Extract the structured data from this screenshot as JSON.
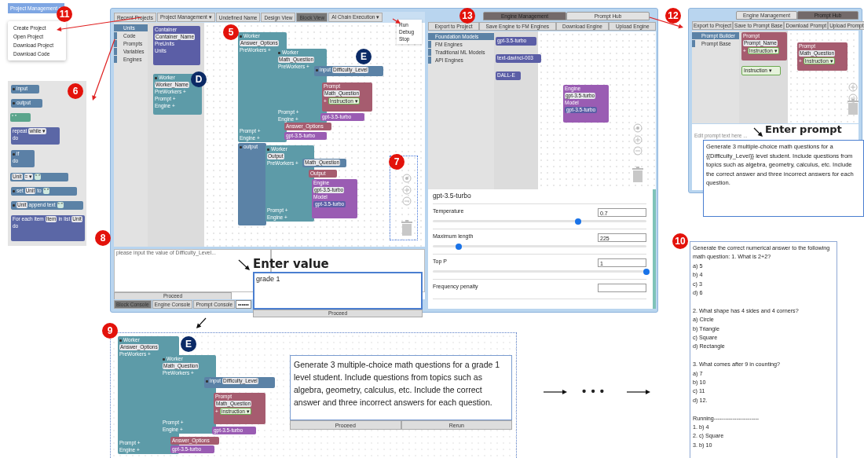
{
  "project_menu": {
    "button": "Project Management ▾",
    "items": [
      "Create Project",
      "Open Project",
      "Download Project",
      "Download Code"
    ]
  },
  "block_library": {
    "blocks": [
      {
        "kind": "io",
        "rows": [
          [
            {
              "kind": "grip"
            },
            {
              "kind": "label",
              "text": "input"
            }
          ]
        ]
      },
      {
        "kind": "io",
        "rows": [
          [
            {
              "kind": "grip"
            },
            {
              "kind": "label",
              "text": "output"
            }
          ]
        ]
      },
      {
        "kind": "text",
        "rows": [
          [
            {
              "kind": "label",
              "text": "“ ”"
            }
          ]
        ]
      },
      {
        "kind": "loop",
        "rows": [
          [
            {
              "kind": "label",
              "text": "repeat"
            },
            {
              "kind": "dropdown",
              "text": "while ▾"
            }
          ],
          [
            {
              "kind": "label",
              "text": "do"
            }
          ]
        ]
      },
      {
        "kind": "logic",
        "rows": [
          [
            {
              "kind": "grip"
            },
            {
              "kind": "label",
              "text": "if"
            }
          ],
          [
            {
              "kind": "label",
              "text": "do"
            }
          ]
        ]
      },
      {
        "kind": "var",
        "rows": [
          [
            {
              "kind": "field",
              "text": "Unit"
            },
            {
              "kind": "dropdown",
              "text": "= ▾"
            },
            {
              "kind": "quote",
              "text": "“ ”"
            }
          ]
        ]
      },
      {
        "kind": "var",
        "rows": [
          [
            {
              "kind": "grip"
            },
            {
              "kind": "label",
              "text": "set"
            },
            {
              "kind": "field",
              "text": "Unit"
            },
            {
              "kind": "label",
              "text": "to"
            },
            {
              "kind": "quote",
              "text": "“ ”"
            }
          ]
        ]
      },
      {
        "kind": "var",
        "rows": [
          [
            {
              "kind": "grip"
            },
            {
              "kind": "field",
              "text": "Unit"
            },
            {
              "kind": "label",
              "text": "append text"
            },
            {
              "kind": "quote",
              "text": "“ ”"
            }
          ]
        ]
      },
      {
        "kind": "loop",
        "rows": [
          [
            {
              "kind": "label",
              "text": "For each item"
            },
            {
              "kind": "field",
              "text": "Item"
            },
            {
              "kind": "label",
              "text": "in list"
            },
            {
              "kind": "field",
              "text": "Unit"
            }
          ],
          [
            {
              "kind": "label",
              "text": "do"
            }
          ]
        ]
      }
    ]
  },
  "main_window": {
    "toolbar": [
      {
        "label": "Recent Projects",
        "selected": false
      },
      {
        "label": "Project Management ▾",
        "selected": false
      },
      {
        "label": "Undefined Name",
        "selected": false
      },
      {
        "label": "Design View",
        "selected": false
      },
      {
        "label": "Block View",
        "selected": true
      },
      {
        "label": "AI Chain Execution ▾",
        "selected": false
      }
    ],
    "execution_menu": [
      "Run",
      "Debug",
      "Stop"
    ],
    "categories": [
      {
        "label": "Units",
        "selected": true
      },
      {
        "label": "Code",
        "selected": false
      },
      {
        "label": "Prompts",
        "selected": false
      },
      {
        "label": "Variables",
        "selected": false
      },
      {
        "label": "Engines",
        "selected": false
      }
    ],
    "flyout_blocks": [
      {
        "kind": "container",
        "rows": [
          [
            {
              "kind": "label",
              "text": "Container"
            }
          ],
          [
            {
              "kind": "field",
              "text": "Container_Name"
            }
          ],
          [
            {
              "kind": "label",
              "text": "PreUnits"
            }
          ],
          [
            {
              "kind": "label",
              "text": "Units"
            }
          ]
        ]
      },
      {
        "kind": "worker",
        "rows": [
          [
            {
              "kind": "grip"
            },
            {
              "kind": "label",
              "text": "Worker"
            }
          ],
          [
            {
              "kind": "field",
              "text": "Worker_Name"
            }
          ],
          [
            {
              "kind": "label",
              "text": "PreWorkers +"
            }
          ],
          [
            {
              "kind": "label",
              "text": "Prompt +"
            }
          ],
          [
            {
              "kind": "label",
              "text": "Engine +"
            }
          ]
        ]
      }
    ],
    "canvas_blocks": [
      {
        "kind": "worker",
        "rows": [
          [
            {
              "kind": "grip"
            },
            {
              "kind": "label",
              "text": "Worker"
            }
          ],
          [
            {
              "kind": "field",
              "text": "Answer_Options"
            }
          ],
          [
            {
              "kind": "label",
              "text": "PreWorkers +"
            }
          ],
          [
            {
              "kind": "label",
              "text": "Prompt +"
            }
          ],
          [
            {
              "kind": "label",
              "text": "Engine +"
            }
          ]
        ]
      },
      {
        "kind": "worker",
        "rows": [
          [
            {
              "kind": "grip"
            },
            {
              "kind": "label",
              "text": "Worker"
            }
          ],
          [
            {
              "kind": "field",
              "text": "Math_Question"
            }
          ],
          [
            {
              "kind": "label",
              "text": "PreWorkers +"
            }
          ],
          [
            {
              "kind": "label",
              "text": "Prompt +"
            }
          ],
          [
            {
              "kind": "label",
              "text": "Engine +"
            }
          ]
        ]
      },
      {
        "kind": "io",
        "rows": [
          [
            {
              "kind": "grip"
            },
            {
              "kind": "label",
              "text": "input"
            },
            {
              "kind": "field",
              "text": "Difficulty_Level"
            }
          ]
        ]
      },
      {
        "kind": "prompt",
        "rows": [
          [
            {
              "kind": "label",
              "text": "Prompt"
            }
          ],
          [
            {
              "kind": "field",
              "text": "Math_Question"
            }
          ],
          [
            {
              "kind": "label",
              "text": "+"
            },
            {
              "kind": "instruction",
              "text": "Instruction ▾"
            }
          ]
        ]
      },
      {
        "kind": "engine",
        "rows": [
          [
            {
              "kind": "label",
              "text": "gpt-3.5-turbo"
            }
          ]
        ]
      },
      {
        "kind": "prompt",
        "rows": [
          [
            {
              "kind": "label",
              "text": "Answer_Options"
            }
          ]
        ]
      },
      {
        "kind": "engine",
        "rows": [
          [
            {
              "kind": "label",
              "text": "gpt-3.5-turbo"
            }
          ]
        ]
      },
      {
        "kind": "io",
        "rows": [
          [
            {
              "kind": "grip"
            },
            {
              "kind": "label",
              "text": "output"
            }
          ]
        ]
      },
      {
        "kind": "worker",
        "rows": [
          [
            {
              "kind": "grip"
            },
            {
              "kind": "label",
              "text": "Worker"
            }
          ],
          [
            {
              "kind": "field",
              "text": "Output"
            }
          ],
          [
            {
              "kind": "label",
              "text": "PreWorkers +"
            }
          ],
          [
            {
              "kind": "label",
              "text": "Prompt +"
            }
          ],
          [
            {
              "kind": "label",
              "text": "Engine +"
            }
          ]
        ]
      },
      {
        "kind": "var",
        "rows": [
          [
            {
              "kind": "field",
              "text": "Math_Question"
            }
          ]
        ]
      },
      {
        "kind": "prompt",
        "rows": [
          [
            {
              "kind": "label",
              "text": "Output"
            }
          ]
        ]
      },
      {
        "kind": "engine",
        "rows": [
          [
            {
              "kind": "label",
              "text": "Engine"
            }
          ],
          [
            {
              "kind": "field",
              "text": "gpt-3.5-turbo"
            }
          ],
          [
            {
              "kind": "label",
              "text": "Model"
            }
          ],
          [
            {
              "kind": "model",
              "text": "gpt-3.5-turbo"
            }
          ]
        ]
      }
    ],
    "console": {
      "message": "please input the value of Difficulty_Level...",
      "proceed": "Proceed",
      "tabs": [
        {
          "label": "Block Console",
          "selected": true
        },
        {
          "label": "Engine Console",
          "selected": false
        },
        {
          "label": "Prompt Console",
          "selected": false
        }
      ],
      "field": "••••••"
    },
    "value_entry": {
      "callout": "Enter value",
      "value": "grade 1",
      "proceed": "Proceed"
    }
  },
  "engine_window": {
    "tabs": [
      {
        "label": "Engine Management",
        "selected": true
      },
      {
        "label": "Prompt Hub",
        "selected": false
      }
    ],
    "actions": [
      "Export to Project",
      "Save Engine to FM Engines",
      "Download Engine",
      "Upload Engine"
    ],
    "categories": [
      {
        "label": "Foundation Models",
        "selected": true
      },
      {
        "label": "FM Engines",
        "selected": false
      },
      {
        "label": "Traditional ML Models",
        "selected": false
      },
      {
        "label": "API Engines",
        "selected": false
      }
    ],
    "flyout_blocks": [
      {
        "kind": "model",
        "rows": [
          [
            {
              "kind": "label",
              "text": "gpt-3.5-turbo"
            }
          ]
        ]
      },
      {
        "kind": "model",
        "rows": [
          [
            {
              "kind": "label",
              "text": "text-davinci-003"
            }
          ]
        ]
      },
      {
        "kind": "model",
        "rows": [
          [
            {
              "kind": "label",
              "text": "DALL-E"
            }
          ]
        ]
      }
    ],
    "canvas_blocks": [
      {
        "kind": "engine",
        "rows": [
          [
            {
              "kind": "label",
              "text": "Engine"
            }
          ],
          [
            {
              "kind": "field",
              "text": "gpt-3.5-turbo"
            }
          ],
          [
            {
              "kind": "label",
              "text": "Model"
            }
          ],
          [
            {
              "kind": "model",
              "text": "gpt-3.5-turbo"
            }
          ]
        ]
      }
    ],
    "settings": {
      "title": "gpt-3.5-turbo",
      "params": [
        {
          "label": "Temperature",
          "value": "0.7",
          "level": 0.68
        },
        {
          "label": "Maximum length",
          "value": "225",
          "level": 0.12
        },
        {
          "label": "Top P",
          "value": "1",
          "level": 1
        },
        {
          "label": "Frequency penalty"
        }
      ]
    }
  },
  "prompt_hub": {
    "tabs": [
      {
        "label": "Engine Management",
        "selected": false
      },
      {
        "label": "Prompt Hub",
        "selected": true
      }
    ],
    "actions": [
      "Export to Project",
      "Save to Prompt Base",
      "Download Prompt",
      "Upload Prompt"
    ],
    "categories": [
      {
        "label": "Prompt Builder",
        "selected": true
      },
      {
        "label": "Prompt Base",
        "selected": false
      }
    ],
    "flyout_blocks": [
      {
        "kind": "prompt",
        "rows": [
          [
            {
              "kind": "label",
              "text": "Prompt"
            }
          ],
          [
            {
              "kind": "field",
              "text": "Prompt_Name"
            }
          ],
          [
            {
              "kind": "label",
              "text": "+"
            },
            {
              "kind": "instruction",
              "text": "Instruction ▾"
            }
          ]
        ]
      },
      {
        "kind": "instruction",
        "rows": [
          [
            {
              "kind": "label",
              "text": "Instruction ▾"
            }
          ]
        ]
      }
    ],
    "canvas_blocks": [
      {
        "kind": "prompt",
        "rows": [
          [
            {
              "kind": "label",
              "text": "Prompt"
            }
          ],
          [
            {
              "kind": "field",
              "text": "Math_Question"
            }
          ],
          [
            {
              "kind": "label",
              "text": "+"
            },
            {
              "kind": "instruction",
              "text": "Instruction ▾"
            }
          ]
        ]
      }
    ],
    "editor_placeholder": "Edit prompt text here ...",
    "callout": "Enter prompt",
    "prompt_text": "Generate 3 multiple-choice math questions for a {{Difficulty_Level}} level student. Include questions from topics such as algebra, geometry, calculus, etc. Include the correct answer and three incorrect answers for each question."
  },
  "run_view": {
    "blocks": [
      {
        "kind": "worker",
        "rows": [
          [
            {
              "kind": "grip"
            },
            {
              "kind": "label",
              "text": "Worker"
            }
          ],
          [
            {
              "kind": "field",
              "text": "Answer_Options"
            }
          ],
          [
            {
              "kind": "label",
              "text": "PreWorkers +"
            }
          ],
          [
            {
              "kind": "label",
              "text": "Prompt +"
            }
          ],
          [
            {
              "kind": "label",
              "text": "Engine +"
            }
          ]
        ]
      },
      {
        "kind": "worker",
        "rows": [
          [
            {
              "kind": "grip"
            },
            {
              "kind": "label",
              "text": "Worker"
            }
          ],
          [
            {
              "kind": "field",
              "text": "Math_Question"
            }
          ],
          [
            {
              "kind": "label",
              "text": "PreWorkers +"
            }
          ],
          [
            {
              "kind": "label",
              "text": "Prompt +"
            }
          ],
          [
            {
              "kind": "label",
              "text": "Engine +"
            }
          ]
        ]
      },
      {
        "kind": "io",
        "rows": [
          [
            {
              "kind": "grip"
            },
            {
              "kind": "label",
              "text": "input"
            },
            {
              "kind": "field",
              "text": "Difficulty_Level"
            }
          ]
        ]
      },
      {
        "kind": "prompt",
        "rows": [
          [
            {
              "kind": "label",
              "text": "Prompt"
            }
          ],
          [
            {
              "kind": "field",
              "text": "Math_Question"
            }
          ],
          [
            {
              "kind": "label",
              "text": "+"
            },
            {
              "kind": "instruction",
              "text": "Instruction ▾"
            }
          ]
        ]
      },
      {
        "kind": "engine",
        "rows": [
          [
            {
              "kind": "label",
              "text": "gpt-3.5-turbo"
            }
          ]
        ]
      },
      {
        "kind": "prompt",
        "rows": [
          [
            {
              "kind": "label",
              "text": "Answer_Options"
            }
          ]
        ]
      },
      {
        "kind": "engine",
        "rows": [
          [
            {
              "kind": "label",
              "text": "gpt-3.5-turbo"
            }
          ]
        ]
      }
    ],
    "prompt_text": "Generate 3 multiple-choice math questions for a grade 1 level student. Include questions from topics such as algebra, geometry, calculus, etc. Include the correct answer and three incorrect answers for each question.",
    "buttons": [
      "Proceed",
      "Rerun"
    ],
    "ellipsis": "• • •"
  },
  "output": {
    "groups": [
      [
        "Generate the correct numerical answer to the following math question: 1. What is 2+2?",
        "a) 5",
        "b) 4",
        "c) 3",
        "d) 6"
      ],
      [
        "2. What shape has 4 sides and 4 corners?",
        "a) Circle",
        "b) Triangle",
        "c) Square",
        "d) Rectangle"
      ],
      [
        "3. What comes after 9 in counting?",
        "a) 7",
        "b) 10",
        "c) 11",
        "d) 12."
      ],
      [
        "Running------------------------",
        "1. b) 4",
        "2. c) Square",
        "3. b) 10"
      ]
    ]
  },
  "markers": [
    {
      "text": "11",
      "kind": "step"
    },
    {
      "text": "6",
      "kind": "step"
    },
    {
      "text": "5",
      "kind": "step"
    },
    {
      "text": "E",
      "kind": "letter"
    },
    {
      "text": "D",
      "kind": "letter"
    },
    {
      "text": "7",
      "kind": "step"
    },
    {
      "text": "8",
      "kind": "step"
    },
    {
      "text": "9",
      "kind": "step"
    },
    {
      "text": "13",
      "kind": "step"
    },
    {
      "text": "12",
      "kind": "step"
    },
    {
      "text": "10",
      "kind": "step"
    },
    {
      "text": "E",
      "kind": "letter"
    }
  ]
}
